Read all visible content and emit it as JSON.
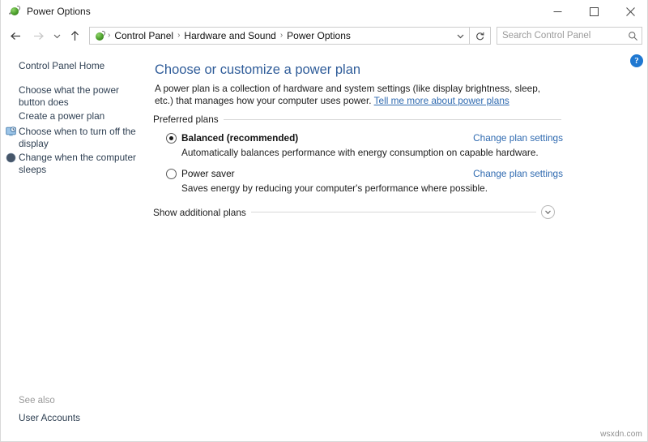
{
  "window": {
    "title": "Power Options",
    "icon": "power-plug-icon",
    "controls": {
      "minimize": "minimize-icon",
      "maximize": "maximize-icon",
      "close": "close-icon"
    }
  },
  "navbar": {
    "back": "back-arrow-icon",
    "forward": "forward-arrow-icon",
    "recent": "recent-locations-chevron-icon",
    "up": "up-arrow-icon",
    "breadcrumb": {
      "icon": "power-plug-icon",
      "separator": "›",
      "items": [
        {
          "label": "Control Panel"
        },
        {
          "label": "Hardware and Sound"
        },
        {
          "label": "Power Options"
        }
      ]
    },
    "dropdown": "chevron-down-icon",
    "refresh": "refresh-icon",
    "search": {
      "placeholder": "Search Control Panel",
      "value": "",
      "icon": "search-icon"
    }
  },
  "sidebar": {
    "items": [
      {
        "label": "Control Panel Home",
        "icon": null
      },
      {
        "label": "Choose what the power button does",
        "icon": null
      },
      {
        "label": "Create a power plan",
        "icon": null
      },
      {
        "label": "Choose when to turn off the display",
        "icon": "display-clock-icon"
      },
      {
        "label": "Change when the computer sleeps",
        "icon": "sleep-moon-icon"
      }
    ],
    "see_also_label": "See also",
    "see_also_items": [
      {
        "label": "User Accounts"
      }
    ]
  },
  "main": {
    "heading": "Choose or customize a power plan",
    "description_before": "A power plan is a collection of hardware and system settings (like display brightness, sleep, etc.) that manages how your computer uses power. ",
    "description_link": "Tell me more about power plans",
    "group_label": "Preferred plans",
    "plans": [
      {
        "name": "Balanced (recommended)",
        "description": "Automatically balances performance with energy consumption on capable hardware.",
        "selected": true,
        "link": "Change plan settings"
      },
      {
        "name": "Power saver",
        "description": "Saves energy by reducing your computer's performance where possible.",
        "selected": false,
        "link": "Change plan settings"
      }
    ],
    "show_additional_label": "Show additional plans",
    "expander_icon": "chevron-down-circle-icon",
    "help_icon": "help-question-icon",
    "help_glyph": "?"
  },
  "watermark": "wsxdn.com",
  "colors": {
    "heading": "#2f5c99",
    "link": "#2f6ab0",
    "sidebar_text": "#2e3f52",
    "help_badge": "#1f78d1",
    "rule": "#d8d8d8"
  }
}
